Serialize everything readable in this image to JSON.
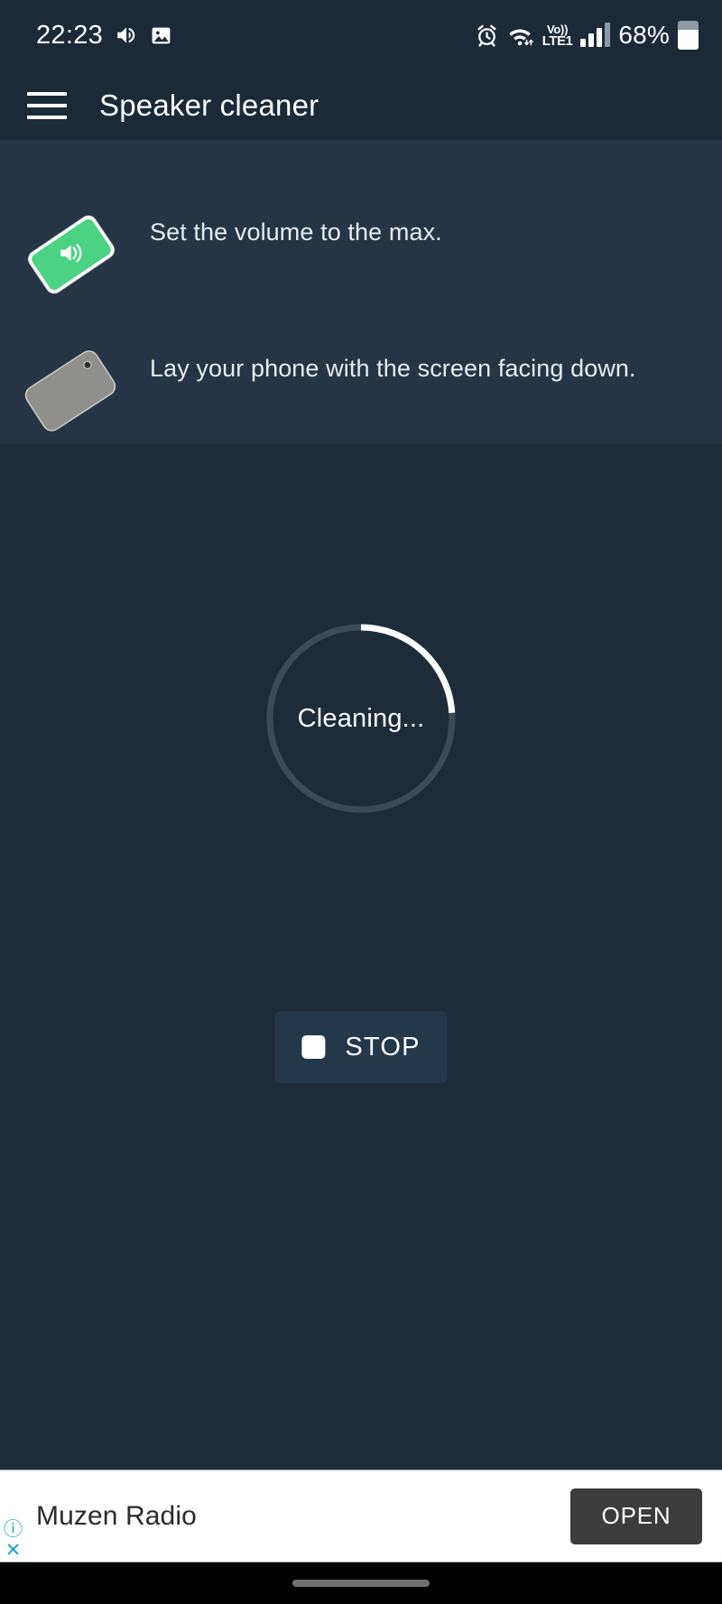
{
  "statusbar": {
    "clock": "22:23",
    "volume_icon": "volume-on-icon",
    "gallery_icon": "image-icon",
    "alarm_icon": "alarm-clock-icon",
    "wifi_icon": "wifi-icon",
    "volte_line1": "Vo))",
    "volte_line2": "LTE1",
    "signal_icon": "signal-bars-icon",
    "battery_text": "68%",
    "battery_icon": "battery-icon",
    "battery_level": 68
  },
  "appbar": {
    "menu_icon": "hamburger-menu-icon",
    "title": "Speaker cleaner"
  },
  "instructions": [
    {
      "icon": "phone-volume-max-icon",
      "text": "Set the volume to the max."
    },
    {
      "icon": "phone-face-down-icon",
      "text": "Lay your phone with the screen facing down."
    }
  ],
  "progress": {
    "label": "Cleaning...",
    "percent": 24,
    "track_color": "#3e4a58",
    "arc_color": "#ffffff"
  },
  "stop_button": {
    "icon": "stop-square-icon",
    "label": "STOP"
  },
  "ad": {
    "title": "Muzen Radio",
    "open_label": "OPEN",
    "info_icon": "info-icon",
    "info_glyph": "ⓘ",
    "close_icon": "close-icon",
    "close_glyph": "✕"
  },
  "navbar": {
    "pill": "home-gesture-pill"
  },
  "colors": {
    "app_background": "#1e2c3a",
    "panel_background": "#253546",
    "appbar_background": "#1c2a38",
    "accent_green": "#4bd282",
    "stop_button_background": "#24384c",
    "ad_button_background": "#3c3c3c",
    "ad_link_color": "#19a7c4"
  }
}
